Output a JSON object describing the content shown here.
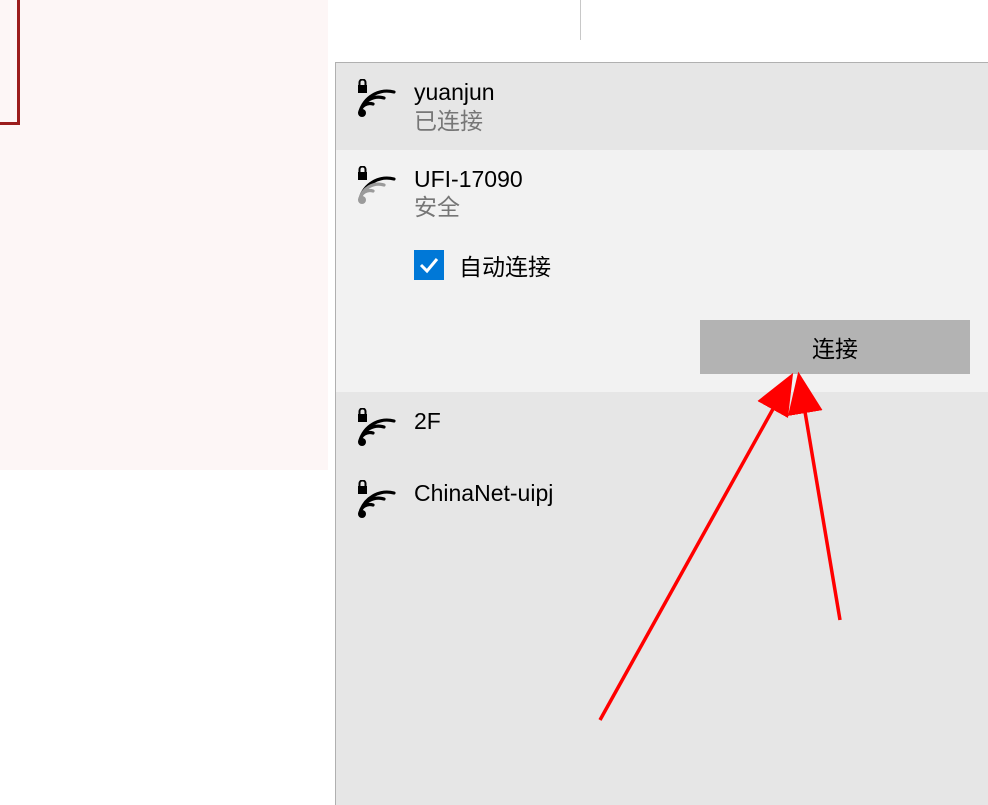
{
  "networks": {
    "0": {
      "name": "yuanjun",
      "status": "已连接"
    },
    "1": {
      "name": "UFI-17090",
      "status": "安全"
    },
    "2": {
      "name": "2F"
    },
    "3": {
      "name": "ChinaNet-uipj"
    }
  },
  "expanded": {
    "auto_connect_label": "自动连接",
    "connect_button": "连接"
  }
}
